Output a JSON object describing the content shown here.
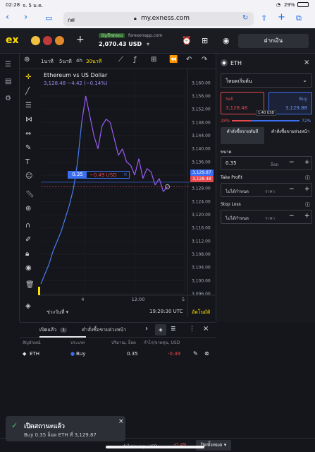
{
  "status": {
    "time": "02:28",
    "date": "จ. 5 ม.ค.",
    "battery": "29%"
  },
  "safari": {
    "tab_text": "กศ",
    "url": "my.exness.com"
  },
  "header": {
    "logo": "ex",
    "demo_label": "บัญชีทดลอง",
    "site": "forexonapp.com",
    "balance": "2,070.43 USD",
    "deposit_label": "ฝากเงิน"
  },
  "chart_toolbar": {
    "intervals": [
      "1นาที",
      "5นาที",
      "4h",
      "30นาที"
    ]
  },
  "chart": {
    "title": "Ethereum vs US Dollar",
    "subtitle": "3,128.48  −4.42 (−0.14%)",
    "time_range_label": "ช่วงวันที่",
    "clock": "19:28:30 UTC",
    "auto_label": "อัตโนมัติ",
    "position_volume": "0.35",
    "position_pnl": "−0.49 USD",
    "ask_price": "3,129.87",
    "bid_price": "3,128.48"
  },
  "chart_data": {
    "type": "line",
    "ylim": [
      3096,
      3162
    ],
    "yticks": [
      "3,160.00",
      "3,156.00",
      "3,152.00",
      "3,148.00",
      "3,144.00",
      "3,140.00",
      "3,136.00",
      "3,132.00",
      "3,128.00",
      "3,124.00",
      "3,120.00",
      "3,116.00",
      "3,112.00",
      "3,108.00",
      "3,104.00",
      "3,100.00",
      "3,096.00"
    ],
    "xticks": [
      {
        "label": "4",
        "x": 0.3
      },
      {
        "label": "12:00",
        "x": 0.65
      },
      {
        "label": "5",
        "x": 1.0
      }
    ],
    "series": [
      {
        "values": [
          3099,
          3102,
          3105,
          3109,
          3112,
          3115,
          3119,
          3123,
          3128,
          3136,
          3148,
          3156,
          3150,
          3144,
          3140,
          3147,
          3149,
          3148,
          3143,
          3138,
          3140,
          3136,
          3135,
          3132,
          3137,
          3131,
          3134,
          3133,
          3129,
          3131,
          3127,
          3128.48
        ],
        "colors": [
          "#4a7df0",
          "#9b5cf5"
        ]
      }
    ]
  },
  "right_panel": {
    "symbol": "ETH",
    "order_type": "โหมดเริ่มต้น",
    "sell_label": "Sell",
    "sell_price": "3,128.48",
    "buy_label": "Buy",
    "buy_price": "3,129.88",
    "spread": "1.40 USD",
    "sell_pct": "28%",
    "buy_pct": "72%",
    "market_order": "คำสั่งซื้อขายทันที",
    "pending_order": "คำสั่งซื้อขายล่วงหน้า",
    "volume_label": "ขนาด",
    "volume_value": "0.35",
    "volume_unit": "ล็อต",
    "tp_label": "Take Profit",
    "tp_value": "ไม่ได้กำหนด",
    "tp_unit": "ราคา",
    "sl_label": "Stop Loss",
    "sl_value": "ไม่ได้กำหนด",
    "sl_unit": "ราคา"
  },
  "bottom": {
    "tab_open": "เปิดแล้ว",
    "open_count": "1",
    "tab_pending": "คำสั่งซื้อขายล่วงหน้า",
    "headers": [
      "สัญลักษณ์",
      "ประเภท",
      "ปริมาณ, ล็อต",
      "กำไร/ขาดทุน, USD"
    ],
    "row": {
      "symbol": "ETH",
      "type": "Buy",
      "volume": "0.35",
      "pnl": "-0.49"
    },
    "footer_label": "กำไร/ขาดทุน USD:",
    "footer_value": "-0.49",
    "close_all": "ปิดทั้งหมด"
  },
  "toast": {
    "title": "เปิดสถานะแล้ว",
    "text": "Buy 0.35 ล็อต ETH ที่ 3,129.87"
  },
  "colors": {
    "accent": "#ffde02",
    "sell": "#e5484d",
    "buy": "#3b6ef0",
    "line_up": "#4a7df0",
    "line_high": "#9b5cf5"
  }
}
